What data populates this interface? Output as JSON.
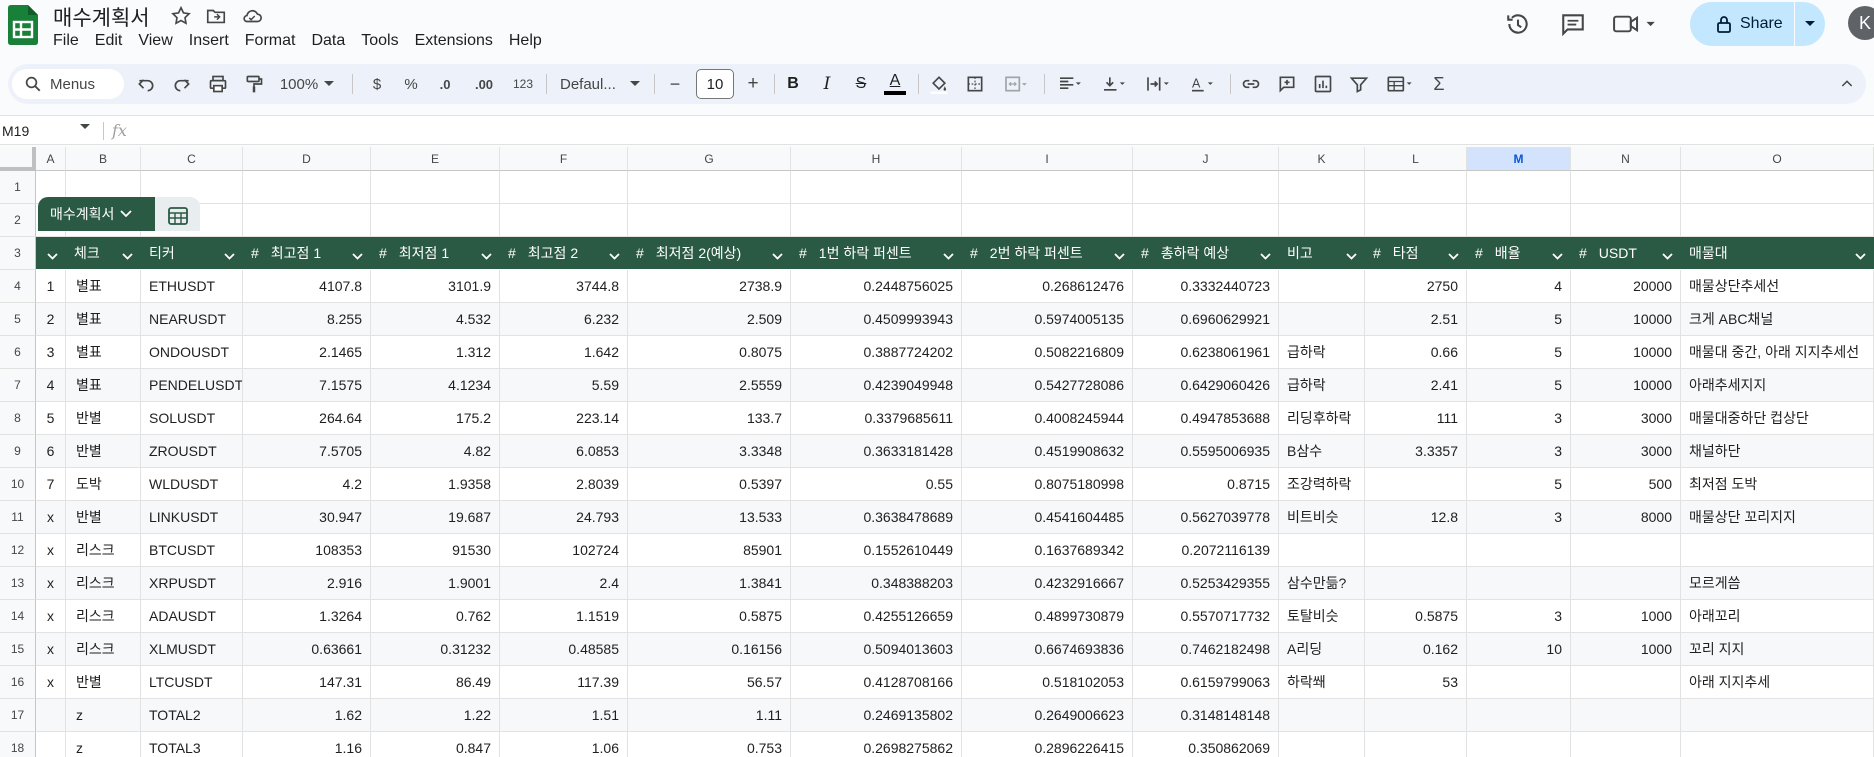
{
  "app": {
    "doc_title": "매수계획서",
    "menu": [
      "File",
      "Edit",
      "View",
      "Insert",
      "Format",
      "Data",
      "Tools",
      "Extensions",
      "Help"
    ],
    "share_label": "Share",
    "avatar_letter": "K"
  },
  "toolbar": {
    "menus_label": "Menus",
    "zoom": "100%",
    "currency": "$",
    "percent": "%",
    "dec_decrease": ".0",
    "dec_increase": ".00",
    "number_format": "123",
    "font": "Defaul...",
    "font_size": "10",
    "minus": "−",
    "plus": "+",
    "bold": "B",
    "italic": "I",
    "strike": "S",
    "text_color_letter": "A",
    "sigma": "Σ"
  },
  "formula_bar": {
    "cell_ref": "M19",
    "fx": "fx",
    "content": ""
  },
  "columns": [
    {
      "letter": "A",
      "selected": false
    },
    {
      "letter": "B",
      "selected": false
    },
    {
      "letter": "C",
      "selected": false
    },
    {
      "letter": "D",
      "selected": false
    },
    {
      "letter": "E",
      "selected": false
    },
    {
      "letter": "F",
      "selected": false
    },
    {
      "letter": "G",
      "selected": false
    },
    {
      "letter": "H",
      "selected": false
    },
    {
      "letter": "I",
      "selected": false
    },
    {
      "letter": "J",
      "selected": false
    },
    {
      "letter": "K",
      "selected": false
    },
    {
      "letter": "L",
      "selected": false
    },
    {
      "letter": "M",
      "selected": true
    },
    {
      "letter": "N",
      "selected": false
    },
    {
      "letter": "O",
      "selected": false
    }
  ],
  "row_numbers": [
    "1",
    "2",
    "3",
    "4",
    "5",
    "6",
    "7",
    "8",
    "9",
    "10",
    "11",
    "12",
    "13",
    "14",
    "15",
    "16",
    "17",
    "18"
  ],
  "table": {
    "name": "매수계획서",
    "headers": [
      {
        "label": "",
        "type": "dropdown"
      },
      {
        "label": "체크",
        "type": "dropdown"
      },
      {
        "label": "티커",
        "type": "text"
      },
      {
        "label": "최고점 1",
        "type": "number"
      },
      {
        "label": "최저점 1",
        "type": "number"
      },
      {
        "label": "최고점 2",
        "type": "number"
      },
      {
        "label": "최저점 2(예상)",
        "type": "number"
      },
      {
        "label": "1번 하락 퍼센트",
        "type": "number"
      },
      {
        "label": "2번 하락 퍼센트",
        "type": "number"
      },
      {
        "label": "총하락 예상",
        "type": "number"
      },
      {
        "label": "비고",
        "type": "text"
      },
      {
        "label": "타점",
        "type": "number"
      },
      {
        "label": "배율",
        "type": "number"
      },
      {
        "label": "USDT",
        "type": "number"
      },
      {
        "label": "매물대",
        "type": "text"
      }
    ],
    "rows": [
      [
        "1",
        "별표",
        "ETHUSDT",
        "4107.8",
        "3101.9",
        "3744.8",
        "2738.9",
        "0.2448756025",
        "0.268612476",
        "0.3332440723",
        "",
        "2750",
        "4",
        "20000",
        "매물상단추세선"
      ],
      [
        "2",
        "별표",
        "NEARUSDT",
        "8.255",
        "4.532",
        "6.232",
        "2.509",
        "0.4509993943",
        "0.5974005135",
        "0.6960629921",
        "",
        "2.51",
        "5",
        "10000",
        "크게 ABC채널"
      ],
      [
        "3",
        "별표",
        "ONDOUSDT",
        "2.1465",
        "1.312",
        "1.642",
        "0.8075",
        "0.3887724202",
        "0.5082216809",
        "0.6238061961",
        "급하락",
        "0.66",
        "5",
        "10000",
        "매물대 중간, 아래 지지추세선"
      ],
      [
        "4",
        "별표",
        "PENDELUSDT",
        "7.1575",
        "4.1234",
        "5.59",
        "2.5559",
        "0.4239049948",
        "0.5427728086",
        "0.6429060426",
        "급하락",
        "2.41",
        "5",
        "10000",
        "아래추세지지"
      ],
      [
        "5",
        "반별",
        "SOLUSDT",
        "264.64",
        "175.2",
        "223.14",
        "133.7",
        "0.3379685611",
        "0.4008245944",
        "0.4947853688",
        "리딩후하락",
        "111",
        "3",
        "3000",
        "매물대중하단 컵상단"
      ],
      [
        "6",
        "반별",
        "ZROUSDT",
        "7.5705",
        "4.82",
        "6.0853",
        "3.3348",
        "0.3633181428",
        "0.4519908632",
        "0.5595006935",
        "B삼수",
        "3.3357",
        "3",
        "3000",
        "채널하단"
      ],
      [
        "7",
        "도박",
        "WLDUSDT",
        "4.2",
        "1.9358",
        "2.8039",
        "0.5397",
        "0.55",
        "0.8075180998",
        "0.8715",
        "조강력하락",
        "",
        "5",
        "500",
        "최저점 도박"
      ],
      [
        "x",
        "반별",
        "LINKUSDT",
        "30.947",
        "19.687",
        "24.793",
        "13.533",
        "0.3638478689",
        "0.4541604485",
        "0.5627039778",
        "비트비슷",
        "12.8",
        "3",
        "8000",
        "매물상단 꼬리지지"
      ],
      [
        "x",
        "리스크",
        "BTCUSDT",
        "108353",
        "91530",
        "102724",
        "85901",
        "0.1552610449",
        "0.1637689342",
        "0.2072116139",
        "",
        "",
        "",
        "",
        ""
      ],
      [
        "x",
        "리스크",
        "XRPUSDT",
        "2.916",
        "1.9001",
        "2.4",
        "1.3841",
        "0.348388203",
        "0.4232916667",
        "0.5253429355",
        "삼수만듦?",
        "",
        "",
        "",
        "모르게씀"
      ],
      [
        "x",
        "리스크",
        "ADAUSDT",
        "1.3264",
        "0.762",
        "1.1519",
        "0.5875",
        "0.4255126659",
        "0.4899730879",
        "0.5570717732",
        "토탈비슷",
        "0.5875",
        "3",
        "1000",
        "아래꼬리"
      ],
      [
        "x",
        "리스크",
        "XLMUSDT",
        "0.63661",
        "0.31232",
        "0.48585",
        "0.16156",
        "0.5094013603",
        "0.6674693836",
        "0.7462182498",
        "A리딩",
        "0.162",
        "10",
        "1000",
        "꼬리 지지"
      ],
      [
        "x",
        "반별",
        "LTCUSDT",
        "147.31",
        "86.49",
        "117.39",
        "56.57",
        "0.4128708166",
        "0.518102053",
        "0.6159799063",
        "하락쐐",
        "53",
        "",
        "",
        "아래 지지추세"
      ],
      [
        "",
        "z",
        "TOTAL2",
        "1.62",
        "1.22",
        "1.51",
        "1.11",
        "0.2469135802",
        "0.2649006623",
        "0.3148148148",
        "",
        "",
        "",
        "",
        ""
      ],
      [
        "",
        "z",
        "TOTAL3",
        "1.16",
        "0.847",
        "1.06",
        "0.753",
        "0.2698275862",
        "0.2896226415",
        "0.350862069",
        "",
        "",
        "",
        "",
        ""
      ]
    ]
  },
  "colors": {
    "table_header": "#2a5a43",
    "share_bg": "#c2e7ff",
    "selected_col": "#d3e3fd",
    "logo": "#188038"
  }
}
